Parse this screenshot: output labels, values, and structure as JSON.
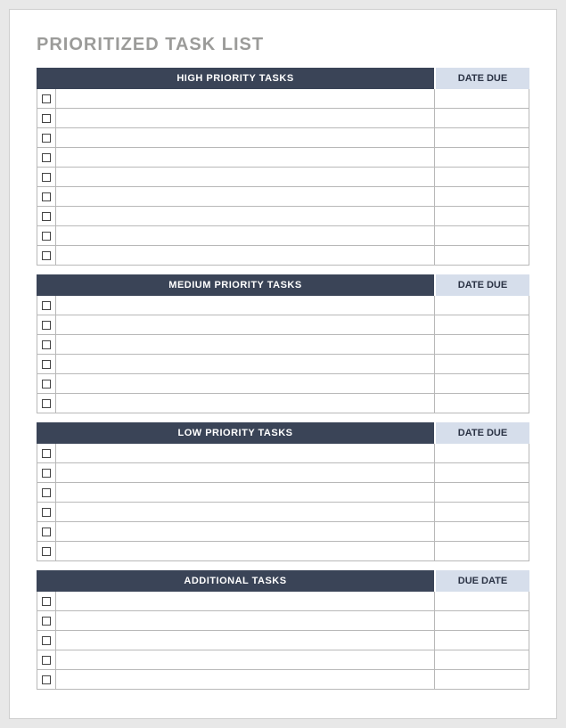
{
  "title": "PRIORITIZED TASK LIST",
  "sections": [
    {
      "task_header": "HIGH PRIORITY TASKS",
      "date_header": "DATE DUE",
      "rows": [
        {
          "checked": false,
          "task": "",
          "date": ""
        },
        {
          "checked": false,
          "task": "",
          "date": ""
        },
        {
          "checked": false,
          "task": "",
          "date": ""
        },
        {
          "checked": false,
          "task": "",
          "date": ""
        },
        {
          "checked": false,
          "task": "",
          "date": ""
        },
        {
          "checked": false,
          "task": "",
          "date": ""
        },
        {
          "checked": false,
          "task": "",
          "date": ""
        },
        {
          "checked": false,
          "task": "",
          "date": ""
        },
        {
          "checked": false,
          "task": "",
          "date": ""
        }
      ]
    },
    {
      "task_header": "MEDIUM PRIORITY TASKS",
      "date_header": "DATE DUE",
      "rows": [
        {
          "checked": false,
          "task": "",
          "date": ""
        },
        {
          "checked": false,
          "task": "",
          "date": ""
        },
        {
          "checked": false,
          "task": "",
          "date": ""
        },
        {
          "checked": false,
          "task": "",
          "date": ""
        },
        {
          "checked": false,
          "task": "",
          "date": ""
        },
        {
          "checked": false,
          "task": "",
          "date": ""
        }
      ]
    },
    {
      "task_header": "LOW PRIORITY TASKS",
      "date_header": "DATE DUE",
      "rows": [
        {
          "checked": false,
          "task": "",
          "date": ""
        },
        {
          "checked": false,
          "task": "",
          "date": ""
        },
        {
          "checked": false,
          "task": "",
          "date": ""
        },
        {
          "checked": false,
          "task": "",
          "date": ""
        },
        {
          "checked": false,
          "task": "",
          "date": ""
        },
        {
          "checked": false,
          "task": "",
          "date": ""
        }
      ]
    },
    {
      "task_header": "ADDITIONAL TASKS",
      "date_header": "DUE DATE",
      "rows": [
        {
          "checked": false,
          "task": "",
          "date": ""
        },
        {
          "checked": false,
          "task": "",
          "date": ""
        },
        {
          "checked": false,
          "task": "",
          "date": ""
        },
        {
          "checked": false,
          "task": "",
          "date": ""
        },
        {
          "checked": false,
          "task": "",
          "date": ""
        }
      ]
    }
  ]
}
